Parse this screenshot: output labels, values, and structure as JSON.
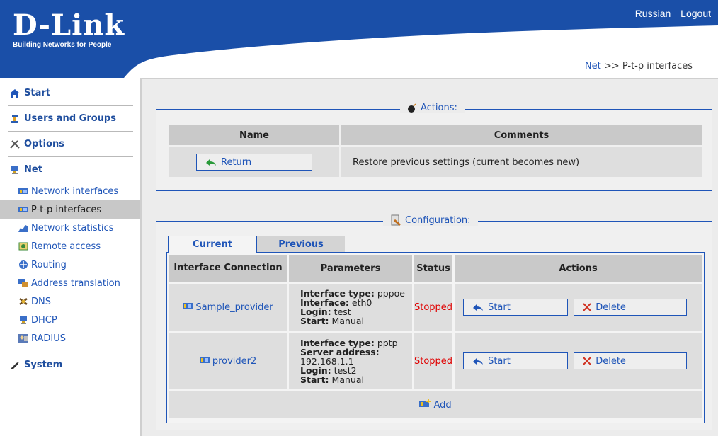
{
  "header": {
    "logo": "D-Link",
    "tagline": "Building Networks for People",
    "links": [
      "Russian",
      "Logout"
    ]
  },
  "breadcrumb": {
    "link": "Net",
    "separator": ">>",
    "current": "P-t-p interfaces"
  },
  "sidebar": {
    "sections": [
      {
        "label": "Start",
        "icon": "home-icon"
      },
      {
        "label": "Users and Groups",
        "icon": "users-icon"
      },
      {
        "label": "Options",
        "icon": "tools-icon"
      },
      {
        "label": "Net",
        "icon": "net-icon"
      },
      {
        "label": "System",
        "icon": "system-icon"
      }
    ],
    "net_items": [
      {
        "label": "Network interfaces",
        "icon": "network-card-icon"
      },
      {
        "label": "P-t-p interfaces",
        "icon": "ptp-icon",
        "active": true
      },
      {
        "label": "Network statistics",
        "icon": "chart-icon"
      },
      {
        "label": "Remote access",
        "icon": "remote-icon"
      },
      {
        "label": "Routing",
        "icon": "routing-icon"
      },
      {
        "label": "Address translation",
        "icon": "nat-icon"
      },
      {
        "label": "DNS",
        "icon": "dns-icon"
      },
      {
        "label": "DHCP",
        "icon": "dhcp-icon"
      },
      {
        "label": "RADIUS",
        "icon": "radius-icon"
      }
    ]
  },
  "actions": {
    "legend": "Actions:",
    "headers": [
      "Name",
      "Comments"
    ],
    "return_label": "Return",
    "return_comment": "Restore previous settings (current becomes new)"
  },
  "configuration": {
    "legend": "Configuration:",
    "tabs": [
      "Current",
      "Previous"
    ],
    "headers": [
      "Interface Connection",
      "Parameters",
      "Status",
      "Actions"
    ],
    "rows": [
      {
        "name": "Sample_provider",
        "params": [
          {
            "k": "Interface type:",
            "v": "pppoe"
          },
          {
            "k": "Interface:",
            "v": "eth0"
          },
          {
            "k": "Login:",
            "v": "test"
          },
          {
            "k": "Start:",
            "v": "Manual"
          }
        ],
        "status": "Stopped",
        "start_label": "Start",
        "delete_label": "Delete"
      },
      {
        "name": "provider2",
        "params": [
          {
            "k": "Interface type:",
            "v": "pptp"
          },
          {
            "k": "Server address:",
            "v": "192.168.1.1"
          },
          {
            "k": "Login:",
            "v": "test2"
          },
          {
            "k": "Start:",
            "v": "Manual"
          }
        ],
        "status": "Stopped",
        "start_label": "Start",
        "delete_label": "Delete"
      }
    ],
    "add_label": "Add"
  },
  "colors": {
    "brand_blue": "#1a4fa8",
    "link_blue": "#1f55b8",
    "status_red": "#e00000"
  }
}
